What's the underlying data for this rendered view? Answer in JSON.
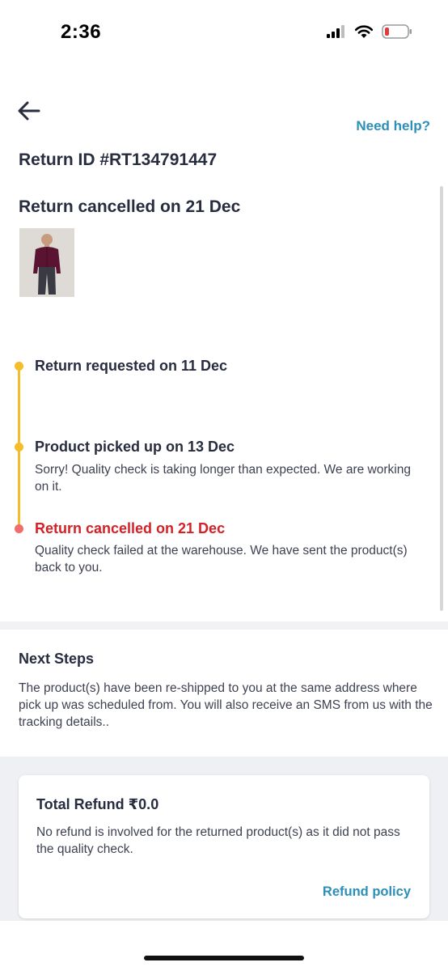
{
  "status_bar": {
    "time": "2:36"
  },
  "header": {
    "help_label": "Need help?"
  },
  "return_info": {
    "return_id": "Return ID #RT134791447",
    "status_heading": "Return cancelled on 21 Dec"
  },
  "timeline": [
    {
      "title": "Return requested on 11 Dec",
      "description": "",
      "color": "#f4bd2c"
    },
    {
      "title": "Product picked up on 13 Dec",
      "description": "Sorry! Quality check is taking longer than expected. We are working on it.",
      "color": "#f4bd2c"
    },
    {
      "title": "Return cancelled on 21 Dec",
      "description": "Quality check failed at the warehouse. We have sent the product(s) back to you.",
      "color": "#ef6d6d"
    }
  ],
  "next_steps": {
    "title": "Next Steps",
    "text": "The product(s) have been re-shipped to you at the same address where pick up was scheduled from. You will also receive an SMS from us with the tracking details.."
  },
  "refund": {
    "title": "Total Refund ₹0.0",
    "text": "No refund is involved for the returned product(s) as it did not pass the quality check.",
    "policy_label": "Refund policy"
  },
  "colors": {
    "accent_link": "#2b8fb8",
    "cancel_red": "#d42026",
    "timeline_yellow": "#f4bd2c"
  },
  "icons": {
    "back": "back-arrow-icon",
    "signal": "cellular-signal-icon",
    "wifi": "wifi-icon",
    "battery": "battery-low-icon"
  }
}
